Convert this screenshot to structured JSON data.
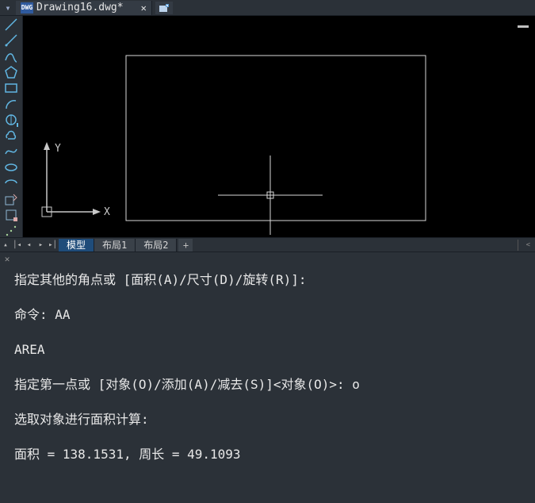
{
  "tabbar": {
    "file_name": "Drawing16.dwg*",
    "dwg_badge": "DWG"
  },
  "tools": [
    {
      "name": "line-icon"
    },
    {
      "name": "ray-icon"
    },
    {
      "name": "polyline-icon"
    },
    {
      "name": "polygon-icon"
    },
    {
      "name": "rectangle-icon"
    },
    {
      "name": "arc-icon"
    },
    {
      "name": "helix-icon"
    },
    {
      "name": "cloud-icon"
    },
    {
      "name": "spline-icon"
    },
    {
      "name": "ellipse-icon"
    },
    {
      "name": "ellipse-arc-icon"
    },
    {
      "name": "block-insert-icon"
    },
    {
      "name": "block-create-icon"
    },
    {
      "name": "point-divide-icon"
    },
    {
      "name": "hatch-icon"
    },
    {
      "name": "gradient-icon"
    },
    {
      "name": "table-grid-icon"
    },
    {
      "name": "region-icon"
    }
  ],
  "ucs": {
    "x_label": "X",
    "y_label": "Y"
  },
  "layout": {
    "tabs": [
      {
        "label": "模型",
        "active": true
      },
      {
        "label": "布局1",
        "active": false
      },
      {
        "label": "布局2",
        "active": false
      }
    ]
  },
  "console": {
    "lines": [
      "指定其他的角点或 [面积(A)/尺寸(D)/旋转(R)]:",
      "命令: AA",
      "AREA",
      "指定第一点或 [对象(O)/添加(A)/减去(S)]<对象(O)>: o",
      "选取对象进行面积计算:",
      "面积 = 138.1531, 周长 = 49.1093"
    ]
  },
  "chart_data": {
    "type": "table",
    "title": "AREA command result",
    "rows": [
      {
        "label": "面积",
        "value": 138.1531
      },
      {
        "label": "周长",
        "value": 49.1093
      }
    ]
  }
}
